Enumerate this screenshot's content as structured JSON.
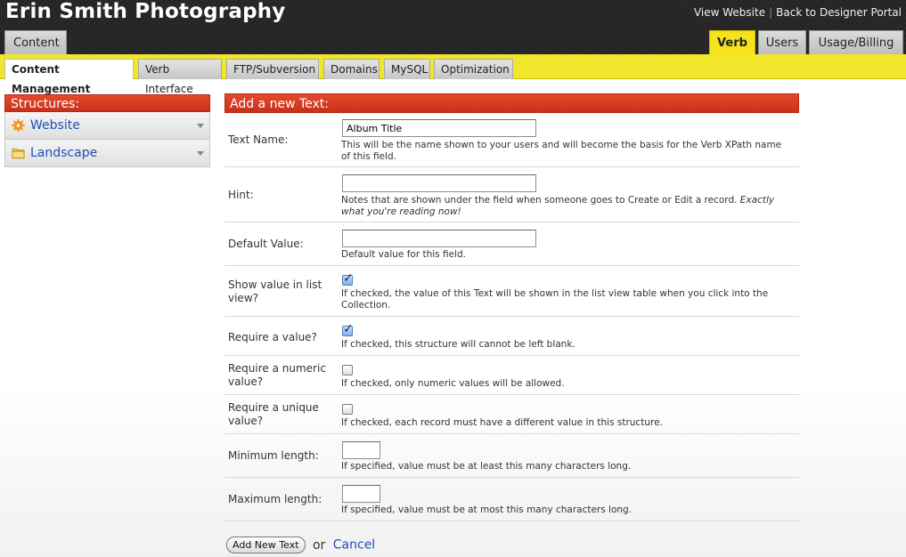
{
  "header": {
    "site_title": "Erin Smith Photography",
    "view_website": "View Website",
    "back_link": "Back to Designer Portal",
    "content_tab": "Content",
    "right_tabs": [
      "Verb",
      "Users",
      "Usage/Billing"
    ]
  },
  "subnav": {
    "tabs": [
      "Content Management",
      "Verb Interface",
      "FTP/Subversion",
      "Domains",
      "MySQL",
      "Optimization"
    ]
  },
  "sidebar": {
    "title": "Structures:",
    "items": [
      {
        "label": "Website",
        "icon": "gear-icon"
      },
      {
        "label": "Landscape",
        "icon": "folder-icon"
      }
    ]
  },
  "form": {
    "title": "Add a new Text:",
    "text_name": {
      "label": "Text Name:",
      "value": "Album Title",
      "help": "This will be the name shown to your users and will become the basis for the Verb XPath name of this field."
    },
    "hint": {
      "label": "Hint:",
      "value": "",
      "help": "Notes that are shown under the field when someone goes to Create or Edit a record.",
      "help_em": "Exactly what you're reading now!"
    },
    "default_value": {
      "label": "Default Value:",
      "value": "",
      "help": "Default value for this field."
    },
    "show_in_list": {
      "label": "Show value in list view?",
      "checked": true,
      "help": "If checked, the value of this Text will be shown in the list view table when you click into the Collection."
    },
    "require_value": {
      "label": "Require a value?",
      "checked": true,
      "help": "If checked, this structure will cannot be left blank."
    },
    "require_numeric": {
      "label": "Require a numeric value?",
      "checked": false,
      "help": "If checked, only numeric values will be allowed."
    },
    "require_unique": {
      "label": "Require a unique value?",
      "checked": false,
      "help": "If checked, each record must have a different value in this structure."
    },
    "min_length": {
      "label": "Minimum length:",
      "value": "",
      "help": "If specified, value must be at least this many characters long."
    },
    "max_length": {
      "label": "Maximum length:",
      "value": "",
      "help": "If specified, value must be at most this many characters long."
    },
    "submit_label": "Add New Text",
    "or_text": "or",
    "cancel_label": "Cancel"
  },
  "colors": {
    "accent_yellow": "#f1e629",
    "header_red": "#d63b22",
    "link_blue": "#1f4fb8"
  }
}
